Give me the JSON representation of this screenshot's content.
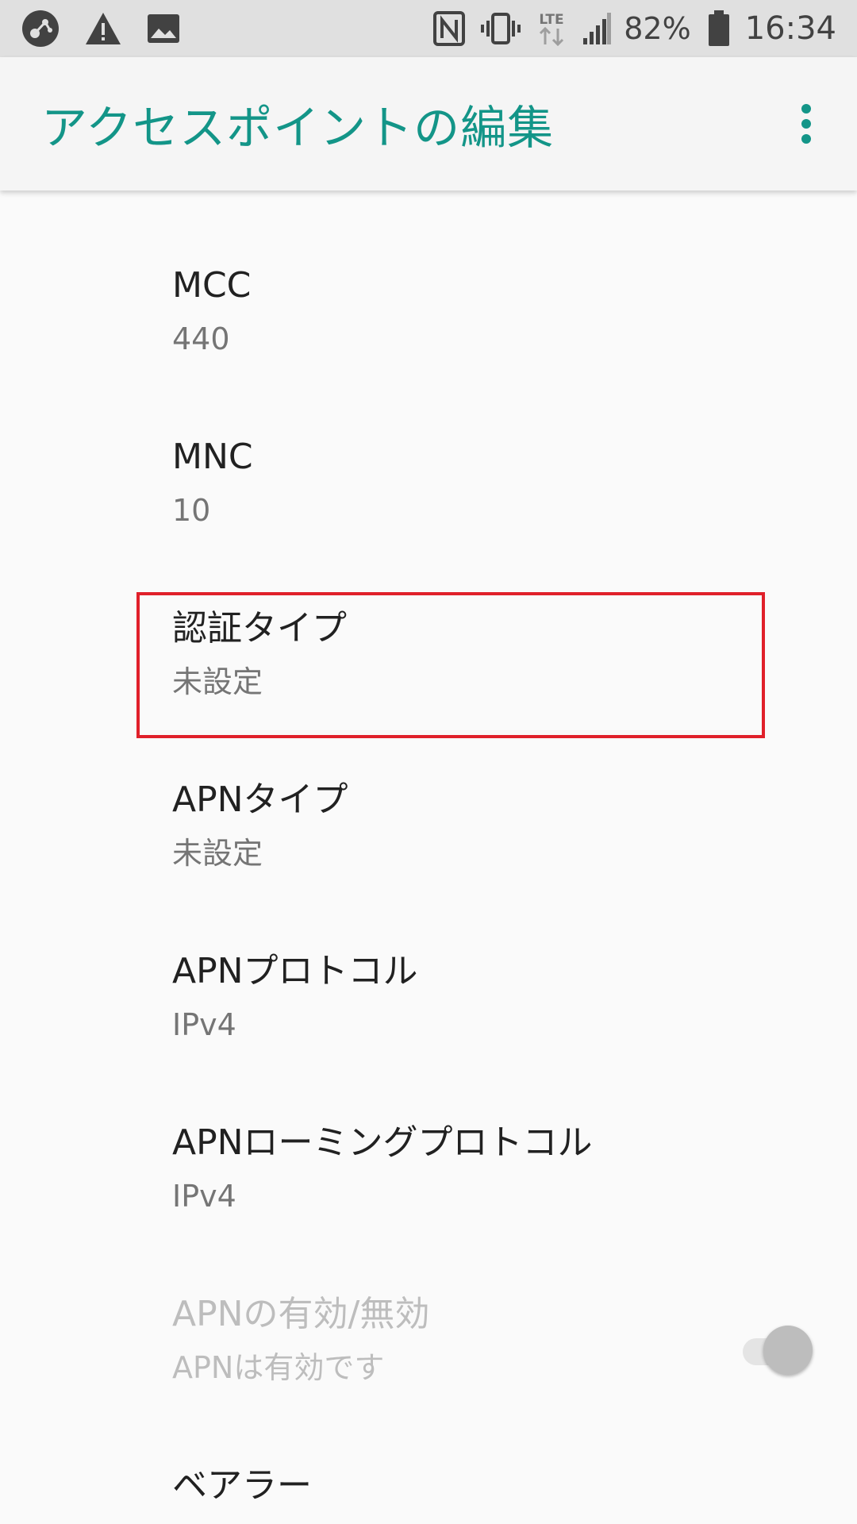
{
  "status_bar": {
    "battery_percent": "82%",
    "network_type": "LTE",
    "time": "16:34",
    "icons_left": [
      "app-notification-icon",
      "warning-icon",
      "image-icon"
    ],
    "icons_right": [
      "nfc-icon",
      "vibrate-icon",
      "lte-icon",
      "signal-icon",
      "battery-icon"
    ]
  },
  "toolbar": {
    "title": "アクセスポイントの編集",
    "title_color": "#139588",
    "menu_icon": "more-vert-icon"
  },
  "preferences": [
    {
      "title": "MCC",
      "summary": "440",
      "enabled": true
    },
    {
      "title": "MNC",
      "summary": "10",
      "enabled": true
    },
    {
      "title": "認証タイプ",
      "summary": "未設定",
      "enabled": true,
      "highlighted": true
    },
    {
      "title": "APNタイプ",
      "summary": "未設定",
      "enabled": true
    },
    {
      "title": "APNプロトコル",
      "summary": "IPv4",
      "enabled": true
    },
    {
      "title": "APNローミングプロトコル",
      "summary": "IPv4",
      "enabled": true
    },
    {
      "title": "APNの有効/無効",
      "summary": "APNは有効です",
      "enabled": false,
      "switch_on": true
    },
    {
      "title": "ベアラー",
      "summary": "",
      "enabled": true
    }
  ],
  "highlight_color": "#e0202a"
}
